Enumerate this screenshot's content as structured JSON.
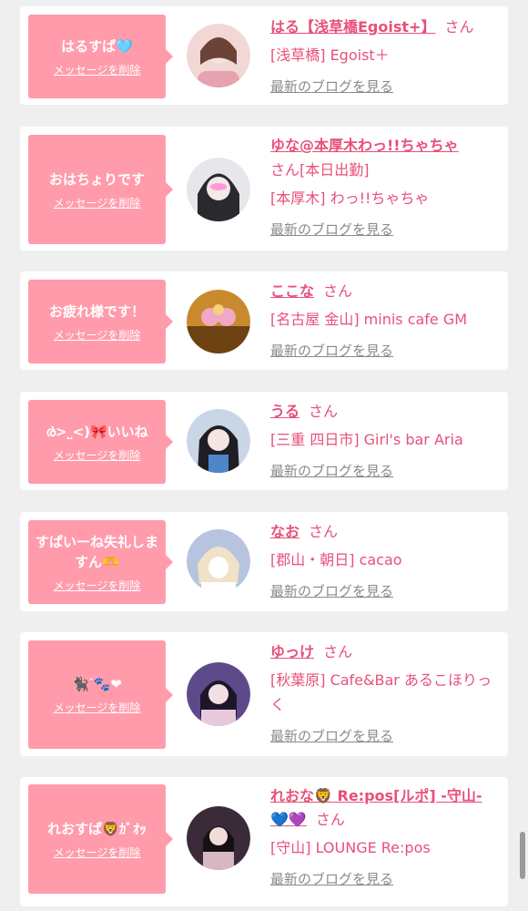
{
  "cards": [
    {
      "message": "はるすぱ🩵",
      "delete_label": "メッセージを削除",
      "name": "はる【浅草橋Egoist+】",
      "honorific": "さん",
      "shop": "[浅草橋] Egoist＋",
      "blog_label": "最新のブログを見る",
      "avatar_colors": [
        "#f3d7d5",
        "#6b4437"
      ]
    },
    {
      "message": "おはちょりです",
      "delete_label": "メッセージを削除",
      "name": "ゆな@本厚木わっ!!ちゃちゃ",
      "honorific": "さん[本日出勤]",
      "shop": "[本厚木] わっ!!ちゃちゃ",
      "blog_label": "最新のブログを見る",
      "avatar_colors": [
        "#e8e6ea",
        "#2a2a2e"
      ]
    },
    {
      "message": "お疲れ様です！",
      "delete_label": "メッセージを削除",
      "name": "ここな",
      "honorific": "さん",
      "shop": "[名古屋 金山] minis cafe GM",
      "blog_label": "最新のブログを見る",
      "avatar_colors": [
        "#c98a2d",
        "#6d4212"
      ]
    },
    {
      "message": "ര̀>˽<)🎀いいね",
      "delete_label": "メッセージを削除",
      "name": "うる",
      "honorific": "さん",
      "shop": "[三重 四日市] Girl's bar Aria",
      "blog_label": "最新のブログを見る",
      "avatar_colors": [
        "#c9d6e6",
        "#1e1e24"
      ]
    },
    {
      "message": "すぱいーね失礼しますん🫶",
      "delete_label": "メッセージを削除",
      "name": "なお",
      "honorific": "さん",
      "shop": "[郡山・朝日] cacao",
      "blog_label": "最新のブログを見る",
      "avatar_colors": [
        "#b7c4e0",
        "#f1e1c6"
      ]
    },
    {
      "message": "🐈‍⬛ᐝ🐾❤︎",
      "delete_label": "メッセージを削除",
      "name": "ゆっけ",
      "honorific": "さん",
      "shop": "[秋葉原] Cafe&Bar あるこほりっく",
      "blog_label": "最新のブログを見る",
      "avatar_colors": [
        "#5d4a8a",
        "#e7c9dd"
      ]
    },
    {
      "message": "れおすぱ🦁ｶﾞｵｯ",
      "delete_label": "メッセージを削除",
      "name": "れおな🦁 Re:pos[ルポ] -守山-💙💜",
      "honorific": "さん",
      "shop": "[守山] LOUNGE Re:pos",
      "blog_label": "最新のブログを見る",
      "avatar_colors": [
        "#3b2a38",
        "#d8b6c4"
      ]
    }
  ]
}
